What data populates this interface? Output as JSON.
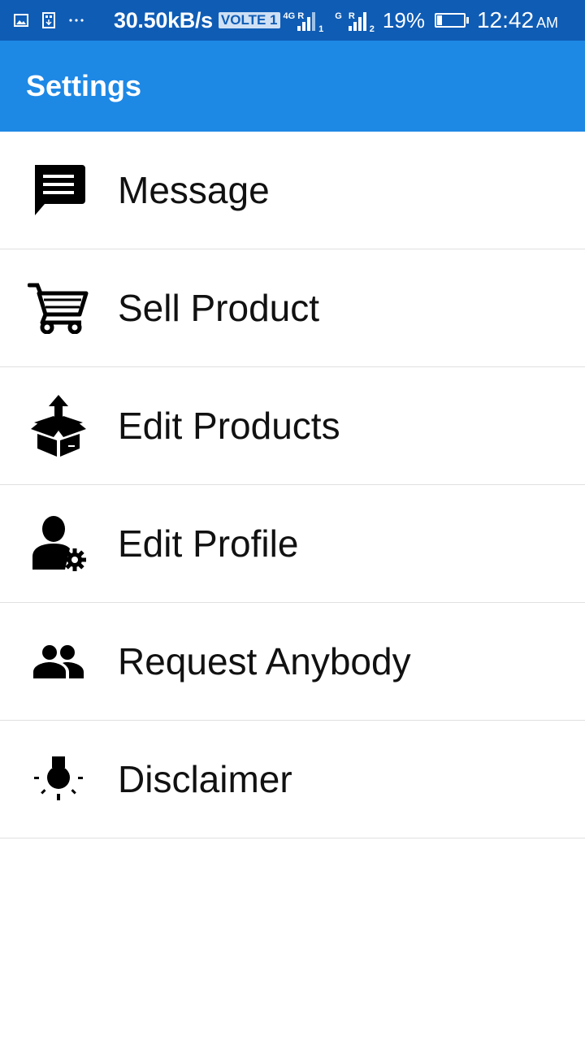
{
  "status_bar": {
    "net_speed": "30.50kB/s",
    "volte_badge": "VOLTE 1",
    "sim1_net_type": "4G",
    "sim1_roaming": "R",
    "sim1_slot": "1",
    "sim2_net_type": "G",
    "sim2_roaming": "R",
    "sim2_slot": "2",
    "battery_percent": "19%",
    "battery_level": 0.19,
    "time": "12:42",
    "am_pm": "AM",
    "left_icons": [
      "gallery-icon",
      "usb-icon",
      "more-notifications-icon"
    ]
  },
  "app_bar": {
    "title": "Settings",
    "color": "#1e88e5"
  },
  "menu": {
    "items": [
      {
        "label": "Message",
        "icon": "message-icon"
      },
      {
        "label": "Sell Product",
        "icon": "shopping-cart-icon"
      },
      {
        "label": "Edit Products",
        "icon": "box-upload-icon"
      },
      {
        "label": "Edit Profile",
        "icon": "user-settings-icon"
      },
      {
        "label": "Request Anybody",
        "icon": "people-icon"
      },
      {
        "label": "Disclaimer",
        "icon": "lightbulb-icon"
      }
    ]
  }
}
